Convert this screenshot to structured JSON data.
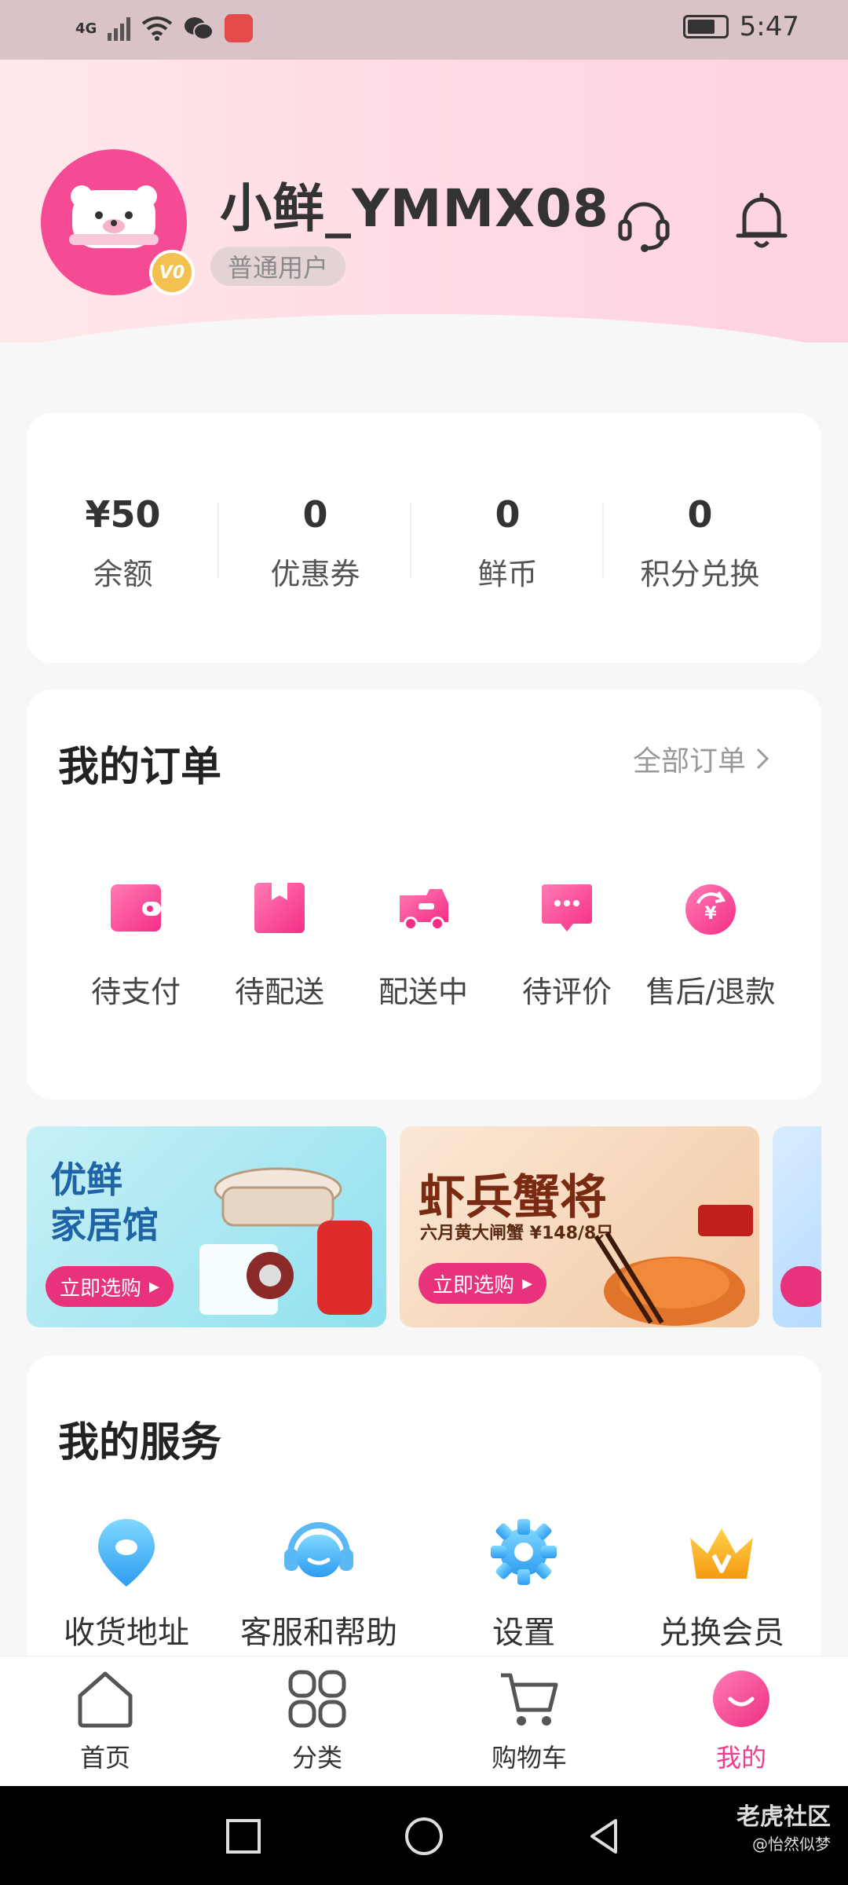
{
  "status_bar": {
    "network": "4G",
    "time": "5:47"
  },
  "header": {
    "username": "小鲜_YMMX08",
    "user_level": "普通用户",
    "vip_badge": "V0",
    "icons": [
      "customer-service-icon",
      "bell-icon"
    ]
  },
  "assets": [
    {
      "value": "¥50",
      "label": "余额"
    },
    {
      "value": "0",
      "label": "优惠券"
    },
    {
      "value": "0",
      "label": "鲜币"
    },
    {
      "value": "0",
      "label": "积分兑换"
    }
  ],
  "orders": {
    "title": "我的订单",
    "all_link": "全部订单",
    "items": [
      {
        "label": "待支付",
        "icon": "wallet-icon"
      },
      {
        "label": "待配送",
        "icon": "package-icon"
      },
      {
        "label": "配送中",
        "icon": "truck-icon"
      },
      {
        "label": "待评价",
        "icon": "comment-icon"
      },
      {
        "label": "售后/退款",
        "icon": "refund-icon"
      }
    ]
  },
  "banners": [
    {
      "title_line1": "优鲜",
      "title_line2": "家居馆",
      "button": "立即选购",
      "bg": "#b9ecf3"
    },
    {
      "title": "虾兵蟹将",
      "subtitle": "六月黄大闸蟹 ¥148/8只",
      "button": "立即选购",
      "bg": "#f6dcc4"
    }
  ],
  "services": {
    "title": "我的服务",
    "items": [
      {
        "label": "收货地址",
        "icon": "location-pin-icon"
      },
      {
        "label": "客服和帮助",
        "icon": "headset-icon"
      },
      {
        "label": "设置",
        "icon": "gear-icon"
      },
      {
        "label": "兑换会员",
        "icon": "crown-icon"
      }
    ]
  },
  "tabbar": {
    "items": [
      {
        "label": "首页",
        "icon": "home-icon"
      },
      {
        "label": "分类",
        "icon": "grid-icon"
      },
      {
        "label": "购物车",
        "icon": "cart-icon"
      },
      {
        "label": "我的",
        "icon": "profile-smile-icon",
        "active": true
      }
    ]
  },
  "watermark": {
    "line1": "老虎社区",
    "line2": "@怡然似梦"
  },
  "colors": {
    "accent": "#ee3f8c",
    "page_bg": "#f7f7f7"
  }
}
